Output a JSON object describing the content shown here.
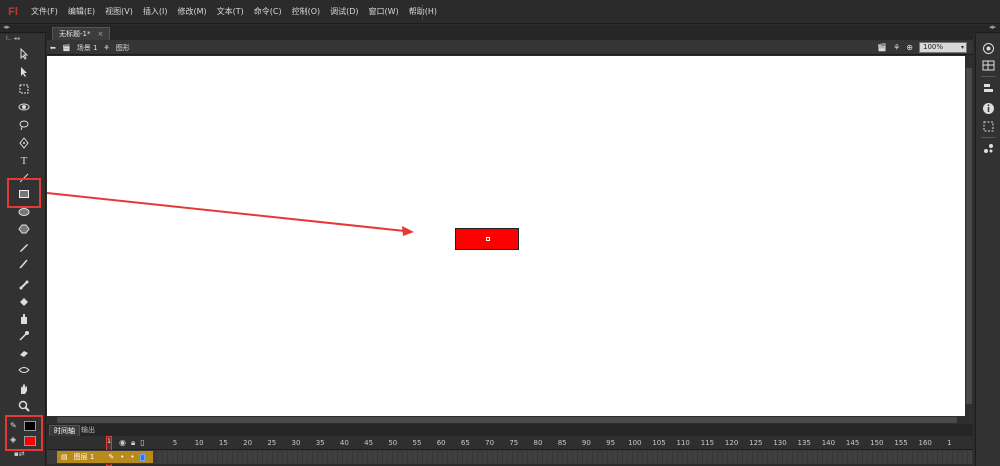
{
  "app": {
    "logo": "Fl",
    "menu": [
      "文件(F)",
      "编辑(E)",
      "视图(V)",
      "插入(I)",
      "修改(M)",
      "文本(T)",
      "命令(C)",
      "控制(O)",
      "调试(D)",
      "窗口(W)",
      "帮助(H)"
    ]
  },
  "toolbar": {
    "header": "I.."
  },
  "document": {
    "tab_title": "无标题-1*",
    "tab_close": "×",
    "scene_label": "场景 1",
    "symbol_label": "图形",
    "zoom": "100%"
  },
  "colors": {
    "stroke": "#000000",
    "fill": "#ff0000",
    "highlight": "#e53935"
  },
  "timeline": {
    "tabs": [
      "时间轴",
      "输出"
    ],
    "layer_name": "图层 1",
    "current_frame": "1",
    "ruler": [
      "5",
      "10",
      "15",
      "20",
      "25",
      "30",
      "35",
      "40",
      "45",
      "50",
      "55",
      "60",
      "65",
      "70",
      "75",
      "80",
      "85",
      "90",
      "95",
      "100",
      "105",
      "110",
      "115",
      "120",
      "125",
      "130",
      "135",
      "140",
      "145",
      "150",
      "155",
      "160",
      "1"
    ]
  }
}
